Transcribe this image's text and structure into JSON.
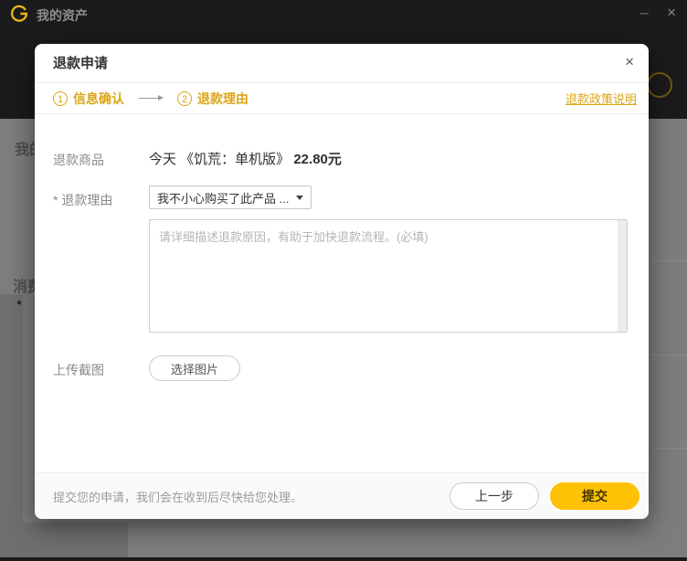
{
  "window": {
    "title": "我的资产",
    "minimize_glyph": "–",
    "close_glyph": "×"
  },
  "background": {
    "partial_label_top": "我的",
    "partial_label_bottom": "消费",
    "bullet_glyph": "●"
  },
  "dialog": {
    "title": "退款申请",
    "close_glyph": "×",
    "steps": [
      {
        "num": "1",
        "label": "信息确认"
      },
      {
        "num": "2",
        "label": "退款理由"
      }
    ],
    "policy_link": "退款政策说明",
    "form": {
      "product_label": "退款商品",
      "product_name": "今天 《饥荒：单机版》",
      "product_price": "22.80元",
      "reason_label": "* 退款理由",
      "reason_selected": "我不小心购买了此产品 ...",
      "reason_placeholder": "请详细描述退款原因，有助于加快退款流程。(必填)",
      "upload_label": "上传截图",
      "upload_button": "选择图片"
    },
    "footer": {
      "note": "提交您的申请，我们会在收到后尽快给您处理。",
      "prev_button": "上一步",
      "submit_button": "提交"
    }
  },
  "colors": {
    "accent_yellow": "#ffc103",
    "step_amber": "#dba617",
    "header_dark": "#1b1b1d",
    "overlay_gray": "#7d7d7d"
  },
  "icons": {
    "logo": "wegame-g-logo",
    "step_arrow": "arrow-right",
    "dropdown_caret": "chevron-down",
    "scrollbar": "vertical-scrollbar-track"
  }
}
